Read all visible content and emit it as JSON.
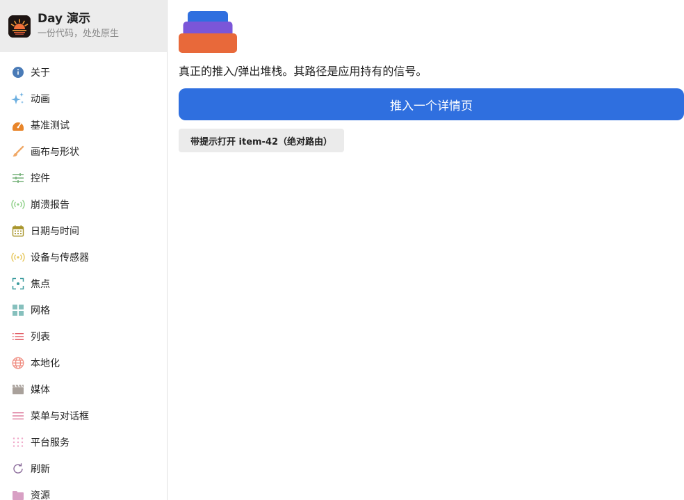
{
  "brand": {
    "title": "Day 演示",
    "subtitle": "一份代码，处处原生"
  },
  "sidebar": {
    "items": [
      {
        "label": "关于",
        "icon": "info-icon",
        "color": "#4a7bb7"
      },
      {
        "label": "动画",
        "icon": "sparkles-icon",
        "color": "#6aaee0"
      },
      {
        "label": "基准测试",
        "icon": "gauge-icon",
        "color": "#e8852a"
      },
      {
        "label": "画布与形状",
        "icon": "paintbrush-icon",
        "color": "#f0a866"
      },
      {
        "label": "控件",
        "icon": "sliders-icon",
        "color": "#6aab6e"
      },
      {
        "label": "崩溃报告",
        "icon": "broadcast-icon",
        "color": "#8dcf86"
      },
      {
        "label": "日期与时间",
        "icon": "calendar-icon",
        "color": "#a8952b"
      },
      {
        "label": "设备与传感器",
        "icon": "sensor-icon",
        "color": "#e6c65a"
      },
      {
        "label": "焦点",
        "icon": "focus-icon",
        "color": "#3a9b9e"
      },
      {
        "label": "网格",
        "icon": "grid-icon",
        "color": "#86c0bd"
      },
      {
        "label": "列表",
        "icon": "list-icon",
        "color": "#e25a62"
      },
      {
        "label": "本地化",
        "icon": "globe-icon",
        "color": "#ef8a7e"
      },
      {
        "label": "媒体",
        "icon": "film-icon",
        "color": "#a9a19b"
      },
      {
        "label": "菜单与对话框",
        "icon": "menu-icon",
        "color": "#d86a90"
      },
      {
        "label": "平台服务",
        "icon": "dots-grid-icon",
        "color": "#f0a8c8"
      },
      {
        "label": "刷新",
        "icon": "refresh-icon",
        "color": "#8a6a9a"
      },
      {
        "label": "资源",
        "icon": "folder-icon",
        "color": "#d8a0c4"
      }
    ]
  },
  "main": {
    "description": "真正的推入/弹出堆栈。其路径是应用持有的信号。",
    "push_button": "推入一个详情页",
    "open_button": "带提示打开 item-42（绝对路由）"
  },
  "colors": {
    "accent": "#2f6fdf",
    "stack_top": "#2f6fdf",
    "stack_mid": "#7b56d8",
    "stack_bottom": "#e8693a"
  }
}
